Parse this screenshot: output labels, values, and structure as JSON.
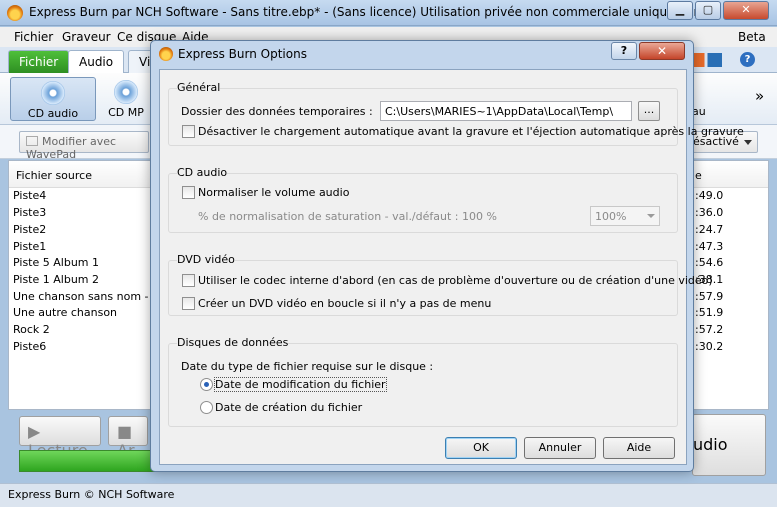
{
  "main": {
    "title": "Express Burn par NCH Software - Sans titre.ebp* - (Sans licence) Utilisation privée non commerciale uniquement",
    "menu": [
      "Fichier",
      "Graveur",
      "Ce disque",
      "Aide"
    ],
    "beta": "Beta",
    "tabs": [
      "Fichier",
      "Audio",
      "Vi"
    ],
    "ribbon": {
      "cd_audio": "CD audio",
      "cd_mp3": "CD MP",
      "right_label": "au",
      "more": "»"
    },
    "toolbar": {
      "modifier": "Modifier avec WavePad",
      "desactive": "ésactivé"
    },
    "filelist": {
      "col_source": "Fichier source",
      "col_duration": "e",
      "rows": [
        {
          "name": "Piste4",
          "dur": ":49.0"
        },
        {
          "name": "Piste3",
          "dur": ":36.0"
        },
        {
          "name": "Piste2",
          "dur": ":24.7"
        },
        {
          "name": "Piste1",
          "dur": ":47.3"
        },
        {
          "name": "Piste 5 Album 1",
          "dur": ":54.6"
        },
        {
          "name": "Piste 1 Album 2",
          "dur": ":38.1"
        },
        {
          "name": "Une chanson sans nom - Cop",
          "dur": ":57.9"
        },
        {
          "name": "Une autre chanson",
          "dur": ":51.9"
        },
        {
          "name": "Rock 2",
          "dur": ":57.2"
        },
        {
          "name": "Piste6",
          "dur": ":30.2"
        }
      ]
    },
    "bottom": {
      "lecture": "Lecture",
      "arret": "Ar",
      "burn": "udio"
    },
    "status": "Express Burn © NCH Software"
  },
  "dialog": {
    "title": "Express Burn Options",
    "help": "?",
    "close": "✕",
    "general": {
      "title": "Général",
      "temp_label": "Dossier des données temporaires :",
      "temp_value": "C:\\Users\\MARIES~1\\AppData\\Local\\Temp\\",
      "browse": "...",
      "autoload": "Désactiver le chargement automatique avant la gravure et l'éjection automatique après la gravure"
    },
    "cd_audio": {
      "title": "CD audio",
      "normalize": "Normaliser le volume audio",
      "percent_label": "% de normalisation de saturation - val./défaut : 100 %",
      "percent_value": "100%"
    },
    "dvd": {
      "title": "DVD vidéo",
      "codec": "Utiliser le codec interne d'abord (en cas de problème d'ouverture ou de création d'une vidéo)",
      "loop": "Créer un DVD vidéo en boucle si il n'y a pas de menu"
    },
    "data_discs": {
      "title": "Disques de données",
      "date_label": "Date du type de fichier requise sur le disque :",
      "modified": "Date de modification du fichier",
      "created": "Date de création du fichier"
    },
    "buttons": {
      "ok": "OK",
      "cancel": "Annuler",
      "help": "Aide"
    }
  }
}
